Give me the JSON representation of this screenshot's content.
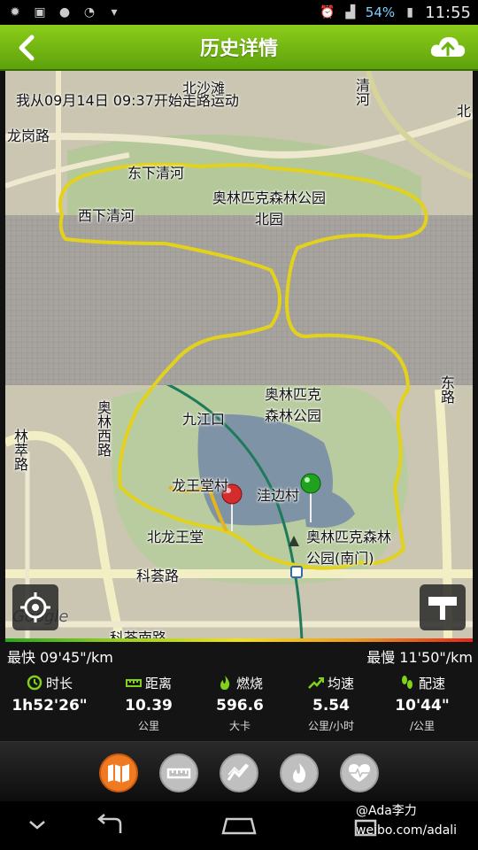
{
  "status_bar": {
    "battery": "54%",
    "time": "11:55",
    "icons": [
      "settings-icon",
      "gallery-icon",
      "app-icon",
      "search-icon",
      "gift-icon",
      "alarm-icon",
      "signal-icon",
      "battery-icon"
    ]
  },
  "header": {
    "title": "历史详情",
    "back_icon": "back-arrow-icon",
    "upload_icon": "cloud-upload-icon"
  },
  "map": {
    "start_text": "我从09月14日 09:37开始走路运动",
    "labels": {
      "beisiwang": "北沙滩",
      "qinghe": "清河",
      "longgang": "龙岗路",
      "dongxia": "东下清河",
      "xixia": "西下清河",
      "olympic_north": "奥林匹克森林公园北园",
      "olympic_forest": "奥林匹克森林公园",
      "jiujiang": "九江口",
      "longwang": "龙王堂村",
      "wabian": "洼边村",
      "beilong": "北龙王堂",
      "olympic_south": "奥林匹克森林公园(南门)",
      "kehui": "科荟路",
      "kehui_south": "科荟南路",
      "aolin_west": "奥林西路",
      "lincui": "林萃路",
      "right_road": "东路",
      "right_edge": "北"
    },
    "watermark_logo": "Google",
    "pins": [
      {
        "name": "end",
        "color": "#d42b2b"
      },
      {
        "name": "start",
        "color": "#1fa31f"
      }
    ]
  },
  "stats": {
    "fastest": "最快 09'45\"/km",
    "slowest": "最慢 11'50\"/km",
    "metrics": [
      {
        "key": "duration",
        "label": "时长",
        "value": "1h52'26\"",
        "unit": "",
        "icon": "clock-icon"
      },
      {
        "key": "distance",
        "label": "距离",
        "value": "10.39",
        "unit": "公里",
        "icon": "ruler-icon"
      },
      {
        "key": "calories",
        "label": "燃烧",
        "value": "596.6",
        "unit": "大卡",
        "icon": "flame-icon"
      },
      {
        "key": "avg_speed",
        "label": "均速",
        "value": "5.54",
        "unit": "公里/小时",
        "icon": "trend-icon"
      },
      {
        "key": "pace",
        "label": "配速",
        "value": "10'44\"",
        "unit": "/公里",
        "icon": "footsteps-icon"
      }
    ]
  },
  "tabs": [
    {
      "name": "map",
      "icon": "map-icon",
      "active": true
    },
    {
      "name": "ruler",
      "icon": "ruler-icon",
      "active": false
    },
    {
      "name": "speed",
      "icon": "speed-chart-icon",
      "active": false
    },
    {
      "name": "calorie",
      "icon": "flame-icon",
      "active": false
    },
    {
      "name": "heart",
      "icon": "heart-rate-icon",
      "active": false
    }
  ],
  "nav": {
    "watermark_user": "@Ada李力",
    "watermark_url": "weibo.com/adali"
  },
  "colors": {
    "header_green": "#6cb312",
    "active_tab": "#f07a22",
    "route": "#e3d21b"
  }
}
